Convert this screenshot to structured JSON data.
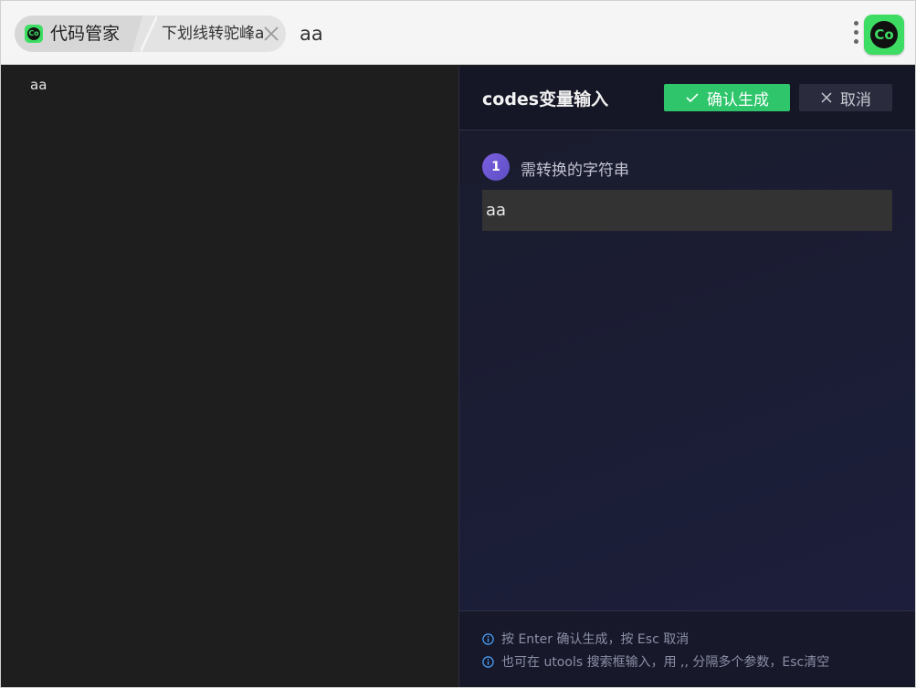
{
  "topbar": {
    "app_name": "代码管家",
    "feature_name": "下划线转驼峰a",
    "search_value": "aa",
    "logo_text": "Co"
  },
  "editor": {
    "lines": [
      "aa"
    ]
  },
  "panel": {
    "title": "codes变量输入",
    "confirm_label": "确认生成",
    "cancel_label": "取消",
    "step_number": "1",
    "step_label": "需转换的字符串",
    "field_value": "aa",
    "tips": [
      "按 Enter 确认生成，按 Esc 取消",
      "也可在 utools 搜索框输入，用 ,, 分隔多个参数，Esc清空"
    ]
  },
  "colors": {
    "accent_green": "#2ec56b",
    "logo_green": "#3ddc63",
    "badge_purple": "#6b57d6",
    "tip_icon": "#4aa3ff"
  }
}
